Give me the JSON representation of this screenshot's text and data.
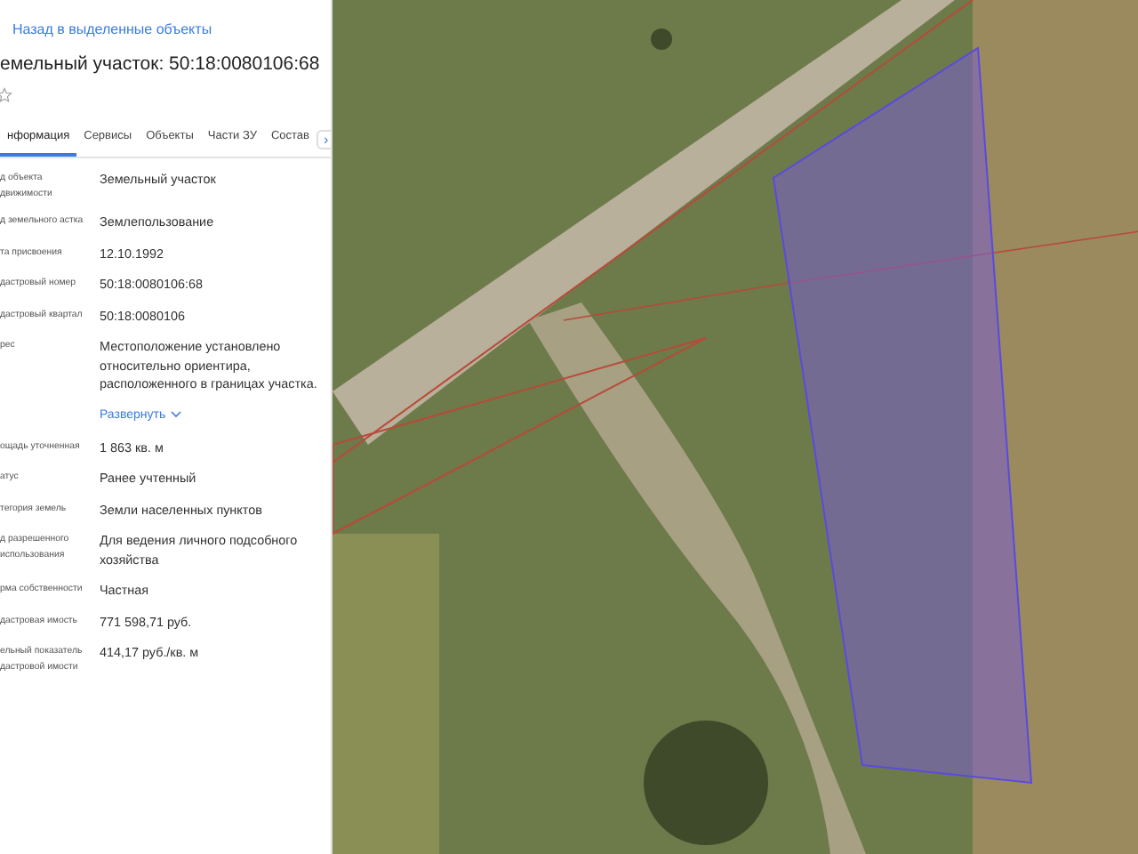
{
  "panel": {
    "back_link": "Назад в выделенные объекты",
    "title": "емельный участок: 50:18:0080106:68",
    "favorite": false,
    "tabs": [
      {
        "label": "нформация",
        "selected": true
      },
      {
        "label": "Сервисы",
        "selected": false
      },
      {
        "label": "Объекты",
        "selected": false
      },
      {
        "label": "Части ЗУ",
        "selected": false
      },
      {
        "label": "Состав",
        "selected": false
      }
    ],
    "tabs_next": "›",
    "fields": [
      {
        "label": "д объекта движимости",
        "value": "Земельный участок"
      },
      {
        "label": "д земельного астка",
        "value": "Землепользование"
      },
      {
        "label": "та присвоения",
        "value": "12.10.1992"
      },
      {
        "label": "дастровый номер",
        "value": "50:18:0080106:68"
      },
      {
        "label": "дастровый квартал",
        "value": "50:18:0080106"
      },
      {
        "label": "рес",
        "value": "Местоположение установлено относительно ориентира, расположенного в границах участка.",
        "expand": "Развернуть"
      },
      {
        "label": "ощадь уточненная",
        "value": "1 863 кв. м"
      },
      {
        "label": "атус",
        "value": "Ранее учтенный"
      },
      {
        "label": "тегория земель",
        "value": "Земли населенных пунктов"
      },
      {
        "label": "д разрешенного использования",
        "value": "Для ведения личного подсобного хозяйства"
      },
      {
        "label": "рма собственности",
        "value": "Частная"
      },
      {
        "label": "дастровая имость",
        "value": "771 598,71 руб."
      },
      {
        "label": "ельный показатель дастровой имости",
        "value": "414,17 руб./кв. м"
      }
    ]
  }
}
